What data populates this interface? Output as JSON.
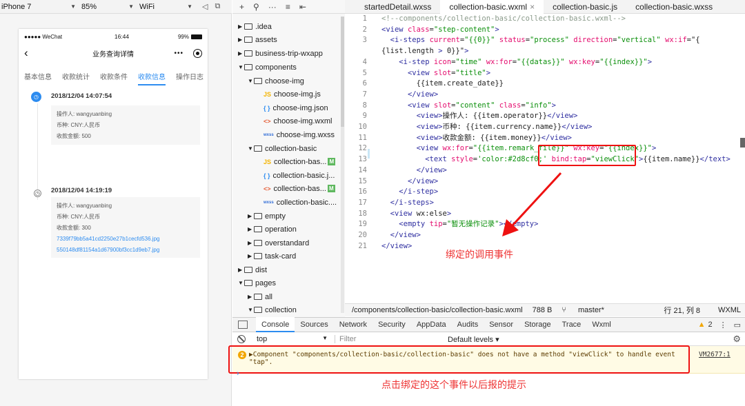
{
  "device_bar": {
    "device": "iPhone 7",
    "zoom": "85%",
    "network": "WiFi"
  },
  "phone": {
    "carrier": "●●●●● WeChat",
    "time": "16:44",
    "battery": "99%",
    "title": "业务查询详情",
    "back": "‹",
    "menu": "•••",
    "tabs": [
      "基本信息",
      "收款统计",
      "收款条件",
      "收款信息",
      "操作日志"
    ],
    "active_tab": 3,
    "steps": [
      {
        "date": "2018/12/04 14:07:54",
        "operator": "操作人: wangyuanbing",
        "currency": "币种: CNY:人民币",
        "money": "收款金额: 500",
        "files": []
      },
      {
        "date": "2018/12/04 14:19:19",
        "operator": "操作人: wangyuanbing",
        "currency": "币种: CNY:人民币",
        "money": "收款金额: 300",
        "files": [
          "7339f79bb5a41cd2250e27b1cecfd536.jpg",
          "550148df81154a1d67900bf3cc1d9eb7.jpg"
        ]
      }
    ]
  },
  "tree": [
    {
      "label": ".idea",
      "type": "folder",
      "open": false
    },
    {
      "label": "assets",
      "type": "folder",
      "open": false
    },
    {
      "label": "business-trip-wxapp",
      "type": "folder",
      "open": false
    },
    {
      "label": "components",
      "type": "folder",
      "open": true
    },
    {
      "label": "choose-img",
      "type": "folder",
      "open": true
    },
    {
      "label": "choose-img.js",
      "type": "js"
    },
    {
      "label": "choose-img.json",
      "type": "json"
    },
    {
      "label": "choose-img.wxml",
      "type": "wxml"
    },
    {
      "label": "choose-img.wxss",
      "type": "wxss"
    },
    {
      "label": "collection-basic",
      "type": "folder",
      "open": true
    },
    {
      "label": "collection-bas...",
      "type": "js",
      "badge": "M"
    },
    {
      "label": "collection-basic.j...",
      "type": "json"
    },
    {
      "label": "collection-bas...",
      "type": "wxml",
      "badge": "M"
    },
    {
      "label": "collection-basic....",
      "type": "wxss"
    },
    {
      "label": "empty",
      "type": "folder",
      "open": false
    },
    {
      "label": "operation",
      "type": "folder",
      "open": false
    },
    {
      "label": "overstandard",
      "type": "folder",
      "open": false
    },
    {
      "label": "task-card",
      "type": "folder",
      "open": false
    },
    {
      "label": "dist",
      "type": "folder",
      "open": false
    },
    {
      "label": "pages",
      "type": "folder",
      "open": true
    },
    {
      "label": "all",
      "type": "folder",
      "open": false
    },
    {
      "label": "collection",
      "type": "folder",
      "open": true
    }
  ],
  "editor_tabs": [
    {
      "label": "startedDetail.wxss",
      "active": false
    },
    {
      "label": "collection-basic.wxml",
      "active": true,
      "close": "×"
    },
    {
      "label": "collection-basic.js",
      "active": false
    },
    {
      "label": "collection-basic.wxss",
      "active": false
    }
  ],
  "code_lines": [
    "<!--components/collection-basic/collection-basic.wxml-->",
    "<view class=\"step-content\">",
    "  <i-steps current=\"{{0}}\" status=\"process\" direction=\"vertical\" wx:if=\"{",
    "{list.length > 0}}\">",
    "    <i-step icon=\"time\" wx:for=\"{{datas}}\" wx:key=\"{{index}}\">",
    "      <view slot=\"title\">",
    "        {{item.create_date}}",
    "      </view>",
    "      <view slot=\"content\" class=\"info\">",
    "        <view>操作人: {{item.operator}}</view>",
    "        <view>币种: {{item.currency.name}}</view>",
    "        <view>收款金额: {{item.money}}</view>",
    "        <view wx:for=\"{{item.remark_file}}\" wx:key=\"{{index}}\">",
    "          <text style='color:#2d8cf0;' bind:tap=\"viewClick\">{{item.name}}</text>",
    "        </view>",
    "      </view>",
    "    </i-step>",
    "  </i-steps>",
    "  <view wx:else>",
    "    <empty tip=\"暂无操作记录\"></empty>",
    "  </view>",
    "</view>"
  ],
  "line_numbers": [
    "1",
    "2",
    "3",
    "",
    "4",
    "5",
    "6",
    "7",
    "8",
    "9",
    "10",
    "11",
    "12",
    "13",
    "14",
    "15",
    "16",
    "17",
    "18",
    "19",
    "20",
    "21"
  ],
  "annotation_bind": "绑定的调用事件",
  "status_bar": {
    "path": "/components/collection-basic/collection-basic.wxml",
    "size": "788 B",
    "branch": "master*",
    "position": "行 21, 列 8",
    "lang": "WXML"
  },
  "console_tabs": [
    "Console",
    "Sources",
    "Network",
    "Security",
    "AppData",
    "Audits",
    "Sensor",
    "Storage",
    "Trace",
    "Wxml"
  ],
  "warning_count": "2",
  "console_bar": {
    "context": "top",
    "filter_placeholder": "Filter",
    "levels": "Default levels ▾"
  },
  "console_msg": {
    "count": "2",
    "text": "▶Component \"components/collection-basic/collection-basic\" does not have a method \"viewClick\" to handle event \"tap\".",
    "source": "VM2677:1"
  },
  "annotation_console": "点击绑定的这个事件以后报的提示",
  "colors": {
    "accent": "#2d8cf0",
    "annotation": "#ee3333",
    "warning": "#f2a600"
  }
}
